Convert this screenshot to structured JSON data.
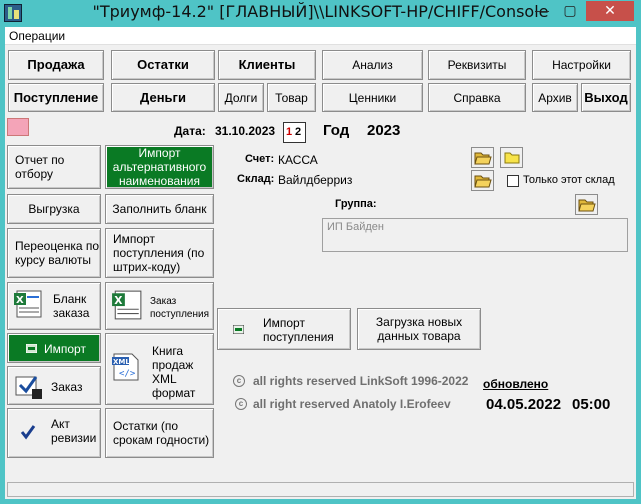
{
  "window": {
    "title": "\"Триумф-14.2\" [ГЛАВНЫЙ]\\\\LINKSOFT-HP/CHIFF/Console"
  },
  "menu": {
    "operations": "Операции"
  },
  "nav": {
    "row1": [
      "Продажа",
      "Остатки",
      "Клиенты",
      "Анализ",
      "Реквизиты",
      "Настройки"
    ],
    "row2": [
      "Поступление",
      "Деньги",
      "Долги",
      "Товар",
      "Ценники",
      "Справка",
      "Архив",
      "Выход"
    ]
  },
  "header": {
    "date_label": "Дата:",
    "date_value": "31.10.2023",
    "year_label": "Год",
    "year_value": "2023"
  },
  "left_buttons": {
    "report": "Отчет по отбору",
    "import_alt": "Импорт альтернативного наименования",
    "export": "Выгрузка",
    "fill_form": "Заполнить бланк",
    "revalue": "Переоценка по курсу валюты",
    "import_receipt_barcode": "Импорт поступления (по штрих-коду)",
    "order_form": "Бланк заказа",
    "order_receipt": "Заказ поступления",
    "import": "Импорт",
    "sales_book": "Книга продаж XML формат",
    "order": "Заказ",
    "audit_act": "Акт ревизии",
    "expiry_stock": "Остатки (по срокам годности)"
  },
  "form": {
    "account_label": "Счет:",
    "account_value": "КАССА",
    "warehouse_label": "Склад:",
    "warehouse_value": "Вайлдберриз",
    "only_this_warehouse": "Только этот склад",
    "group_label": "Группа:",
    "group_value": "ИП Байден"
  },
  "actions": {
    "import_receipt": "Импорт поступления",
    "load_new_goods": "Загрузка новых данных товара"
  },
  "footer": {
    "copyright1": "all rights reserved LinkSoft 1996-2022",
    "copyright2": "all right reserved Anatoly I.Erofeev",
    "updated_label": "обновлено",
    "updated_date": "04.05.2022",
    "updated_time": "05:00"
  },
  "colors": {
    "titlebar": "#4fc4c6",
    "green_button": "#0a7a24",
    "close_button": "#c7504a"
  }
}
